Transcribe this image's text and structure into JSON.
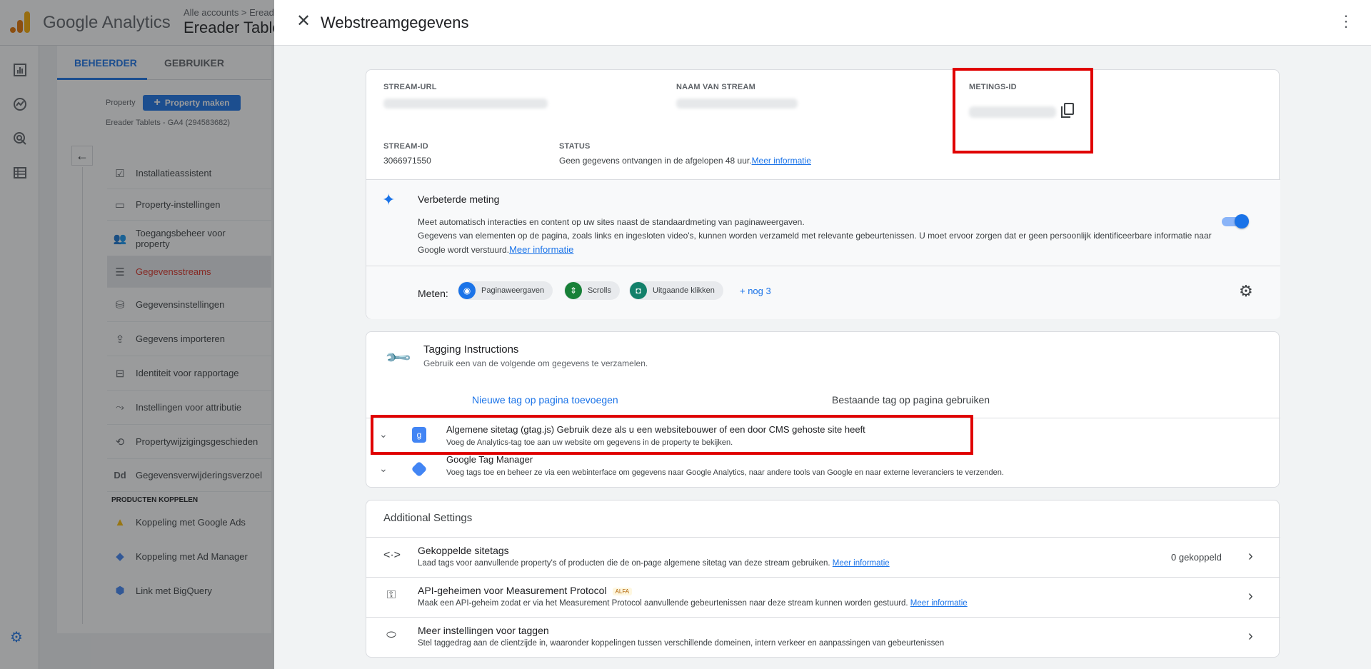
{
  "app": {
    "name": "Google Analytics",
    "breadcrumb": "Alle accounts > Ereade",
    "account_name": "Ereader Table"
  },
  "rail": {
    "icons": [
      "bar-chart-icon",
      "explore-icon",
      "advertising-icon",
      "reports-list-icon"
    ]
  },
  "admin": {
    "tabs": [
      "BEHEERDER",
      "GEBRUIKER"
    ],
    "property_label": "Property",
    "property_button": "Property maken",
    "property_name": "Ereader Tablets - GA4 (294583682)",
    "nav_items": [
      {
        "label": "Installatieassistent",
        "icon": "checklist-icon"
      },
      {
        "label": "Property-instellingen",
        "icon": "property-icon"
      },
      {
        "label": "Toegangsbeheer voor property",
        "icon": "people-icon"
      },
      {
        "label": "Gegevensstreams",
        "icon": "streams-icon"
      },
      {
        "label": "Gegevensinstellingen",
        "icon": "database-icon"
      },
      {
        "label": "Gegevens importeren",
        "icon": "upload-icon"
      },
      {
        "label": "Identiteit voor rapportage",
        "icon": "identity-icon"
      },
      {
        "label": "Instellingen voor attributie",
        "icon": "attribution-icon"
      },
      {
        "label": "Propertywijzigingsgeschieden",
        "icon": "history-icon"
      },
      {
        "label": "Gegevensverwijderingsverzoel",
        "icon": "data-deletion-icon"
      }
    ],
    "section_head": "PRODUCTEN KOPPELEN",
    "link_items": [
      {
        "label": "Koppeling met Google Ads",
        "icon": "google-ads-icon"
      },
      {
        "label": "Koppeling met Ad Manager",
        "icon": "ad-manager-icon"
      },
      {
        "label": "Link met BigQuery",
        "icon": "bigquery-icon"
      }
    ]
  },
  "panel": {
    "title": "Webstreamgegevens",
    "stream": {
      "url_label": "STREAM-URL",
      "name_label": "NAAM VAN STREAM",
      "measurement_label": "METINGS-ID",
      "id_label": "STREAM-ID",
      "id_value": "3066971550",
      "status_label": "STATUS",
      "status_value": "Geen gegevens ontvangen in de afgelopen 48 uur.",
      "status_link": "Meer informatie"
    },
    "enhanced": {
      "title": "Verbeterde meting",
      "line1": "Meet automatisch interacties en content op uw sites naast de standaardmeting van paginaweergaven.",
      "line2": "Gegevens van elementen op de pagina, zoals links en ingesloten video's, kunnen worden verzameld met relevante gebeurtenissen. U moet ervoor zorgen dat er geen persoonlijk identificeerbare informatie naar Google wordt verstuurd.",
      "link": "Meer informatie",
      "enabled": true,
      "meten_label": "Meten:",
      "chips": [
        {
          "label": "Paginaweergaven",
          "icon": "eye-icon",
          "color": "#1a73e8"
        },
        {
          "label": "Scrolls",
          "icon": "scroll-icon",
          "color": "#188038"
        },
        {
          "label": "Uitgaande klikken",
          "icon": "mouse-icon",
          "color": "#12806a"
        }
      ],
      "more": "+ nog 3"
    },
    "tagging": {
      "title": "Tagging Instructions",
      "subtitle": "Gebruik een van de volgende om gegevens te verzamelen.",
      "tab_new": "Nieuwe tag op pagina toevoegen",
      "tab_existing": "Bestaande tag op pagina gebruiken",
      "rows": [
        {
          "title_bold": "Algemene sitetag (gtag.js)",
          "title_rest": " Gebruik deze als u een websitebouwer of een door CMS gehoste site heeft",
          "desc": "Voeg de Analytics-tag toe aan uw website om gegevens in de property te bekijken.",
          "icon": "gtag-icon",
          "color": "#4285f4"
        },
        {
          "title_bold": "Google Tag Manager",
          "title_rest": "",
          "desc": "Voeg tags toe en beheer ze via een webinterface om gegevens naar Google Analytics, naar andere tools van Google en naar externe leveranciers te verzenden.",
          "icon": "tag-manager-icon",
          "color": "#4285f4"
        }
      ]
    },
    "settings": {
      "title": "Additional Settings",
      "rows": [
        {
          "title": "Gekoppelde sitetags",
          "badge": "",
          "desc": "Laad tags voor aanvullende property's of producten die de on-page algemene sitetag van deze stream gebruiken.",
          "link": "Meer informatie",
          "count": "0 gekoppeld",
          "icon": "code-icon"
        },
        {
          "title": "API-geheimen voor Measurement Protocol",
          "badge": "ALFA",
          "desc": "Maak een API-geheim zodat er via het Measurement Protocol aanvullende gebeurtenissen naar deze stream kunnen worden gestuurd.",
          "link": "Meer informatie",
          "count": "",
          "icon": "key-icon"
        },
        {
          "title": "Meer instellingen voor taggen",
          "badge": "",
          "desc": "Stel taggedrag aan de clientzijde in, waaronder koppelingen tussen verschillende domeinen, intern verkeer en aanpassingen van gebeurtenissen",
          "link": "",
          "count": "",
          "icon": "label-icon"
        }
      ]
    }
  }
}
